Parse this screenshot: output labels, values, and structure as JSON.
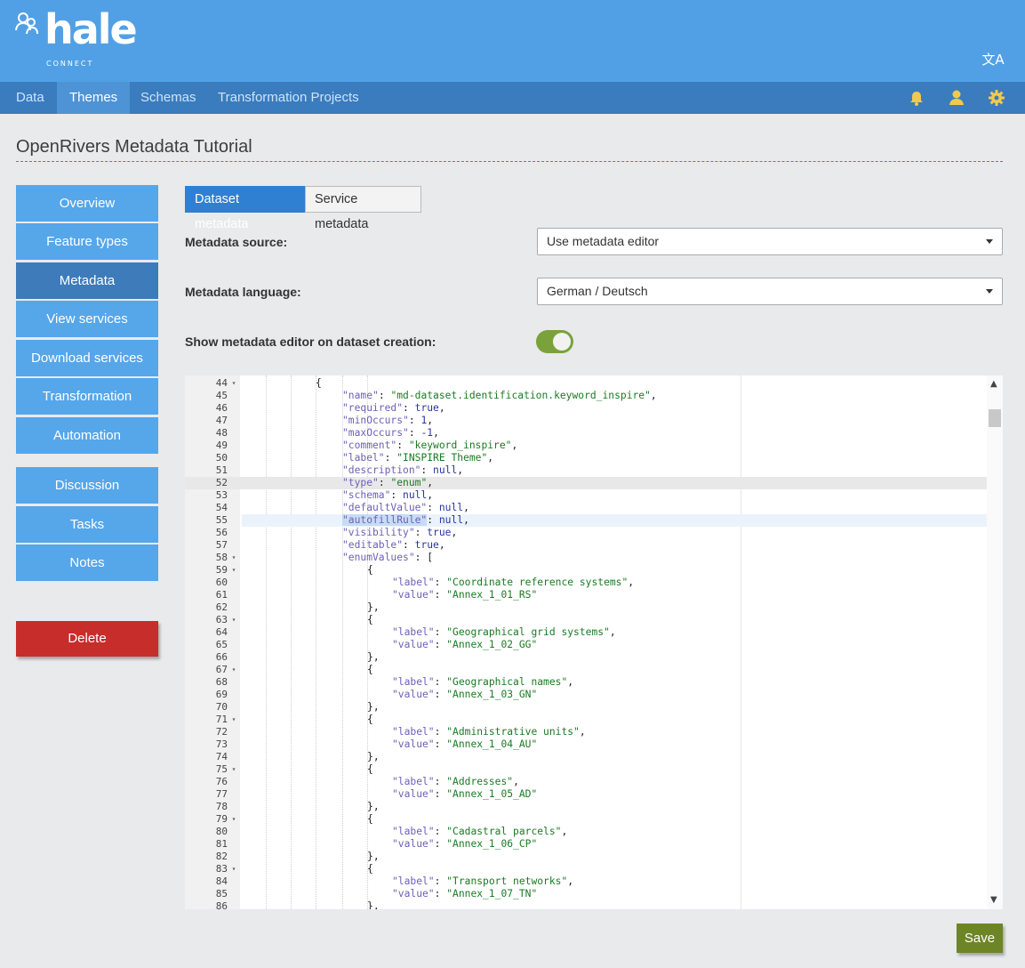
{
  "app": {
    "logo_word": "hale",
    "logo_sub": "CONNECT"
  },
  "header": {
    "lang_icon": "translate-icon"
  },
  "nav": {
    "items": [
      {
        "label": "Data",
        "active": false
      },
      {
        "label": "Themes",
        "active": true
      },
      {
        "label": "Schemas",
        "active": false
      },
      {
        "label": "Transformation Projects",
        "active": false
      }
    ],
    "icons": [
      "bell-icon",
      "user-icon",
      "gear-icon"
    ]
  },
  "page": {
    "title": "OpenRivers Metadata Tutorial"
  },
  "sidebar": {
    "items": [
      {
        "label": "Overview"
      },
      {
        "label": "Feature types"
      },
      {
        "label": "Metadata"
      },
      {
        "label": "View services"
      },
      {
        "label": "Download services"
      },
      {
        "label": "Transformation"
      },
      {
        "label": "Automation"
      },
      {
        "label": "Discussion"
      },
      {
        "label": "Tasks"
      },
      {
        "label": "Notes"
      }
    ],
    "active": "Metadata",
    "delete_label": "Delete"
  },
  "tabs": [
    {
      "label": "Dataset metadata",
      "active": true
    },
    {
      "label": "Service metadata",
      "active": false
    }
  ],
  "form": {
    "source_label": "Metadata source:",
    "source_value": "Use metadata editor",
    "language_label": "Metadata language:",
    "language_value": "German / Deutsch",
    "toggle_label": "Show metadata editor on dataset creation:",
    "toggle_on": true
  },
  "editor": {
    "lines": [
      {
        "n": "44",
        "fold": true,
        "text": "{"
      },
      {
        "n": "45",
        "text": "\"name\": \"md-dataset.identification.keyword_inspire\","
      },
      {
        "n": "46",
        "text": "\"required\": true,"
      },
      {
        "n": "47",
        "text": "\"minOccurs\": 1,"
      },
      {
        "n": "48",
        "text": "\"maxOccurs\": -1,"
      },
      {
        "n": "49",
        "text": "\"comment\": \"keyword_inspire\","
      },
      {
        "n": "50",
        "text": "\"label\": \"INSPIRE Theme\","
      },
      {
        "n": "51",
        "text": "\"description\": null,"
      },
      {
        "n": "52",
        "text": "\"type\": \"enum\","
      },
      {
        "n": "53",
        "text": "\"schema\": null,"
      },
      {
        "n": "54",
        "text": "\"defaultValue\": null,"
      },
      {
        "n": "55",
        "text": "\"autofillRule\": null,"
      },
      {
        "n": "56",
        "text": "\"visibility\": true,"
      },
      {
        "n": "57",
        "text": "\"editable\": true,"
      },
      {
        "n": "58",
        "fold": true,
        "text": "\"enumValues\": ["
      },
      {
        "n": "59",
        "fold": true,
        "text": "{"
      },
      {
        "n": "60",
        "text": "\"label\": \"Coordinate reference systems\","
      },
      {
        "n": "61",
        "text": "\"value\": \"Annex_1_01_RS\""
      },
      {
        "n": "62",
        "text": "},"
      },
      {
        "n": "63",
        "fold": true,
        "text": "{"
      },
      {
        "n": "64",
        "text": "\"label\": \"Geographical grid systems\","
      },
      {
        "n": "65",
        "text": "\"value\": \"Annex_1_02_GG\""
      },
      {
        "n": "66",
        "text": "},"
      },
      {
        "n": "67",
        "fold": true,
        "text": "{"
      },
      {
        "n": "68",
        "text": "\"label\": \"Geographical names\","
      },
      {
        "n": "69",
        "text": "\"value\": \"Annex_1_03_GN\""
      },
      {
        "n": "70",
        "text": "},"
      },
      {
        "n": "71",
        "fold": true,
        "text": "{"
      },
      {
        "n": "72",
        "text": "\"label\": \"Administrative units\","
      },
      {
        "n": "73",
        "text": "\"value\": \"Annex_1_04_AU\""
      },
      {
        "n": "74",
        "text": "},"
      },
      {
        "n": "75",
        "fold": true,
        "text": "{"
      },
      {
        "n": "76",
        "text": "\"label\": \"Addresses\","
      },
      {
        "n": "77",
        "text": "\"value\": \"Annex_1_05_AD\""
      },
      {
        "n": "78",
        "text": "},"
      },
      {
        "n": "79",
        "fold": true,
        "text": "{"
      },
      {
        "n": "80",
        "text": "\"label\": \"Cadastral parcels\","
      },
      {
        "n": "81",
        "text": "\"value\": \"Annex_1_06_CP\""
      },
      {
        "n": "82",
        "text": "},"
      },
      {
        "n": "83",
        "fold": true,
        "text": "{"
      },
      {
        "n": "84",
        "text": "\"label\": \"Transport networks\","
      },
      {
        "n": "85",
        "text": "\"value\": \"Annex_1_07_TN\""
      },
      {
        "n": "86",
        "text": "},"
      }
    ]
  },
  "actions": {
    "save_label": "Save"
  },
  "colors": {
    "header": "#51a0e6",
    "nav": "#3a7cbe",
    "sidebar": "#56a6ea",
    "sidebar_active": "#3d7bba",
    "delete": "#c72d2a",
    "save": "#6e8526",
    "toggle": "#7ba23a"
  }
}
